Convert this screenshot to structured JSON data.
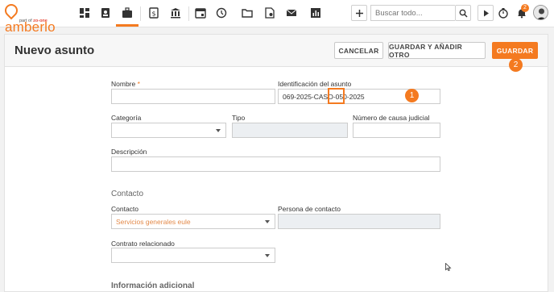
{
  "app": {
    "logo_text": "amberlo",
    "logo_sub_prefix": "part of",
    "logo_sub_brand": "zo-one"
  },
  "nav": {
    "icons": [
      "dashboard-icon",
      "contacts-icon",
      "briefcase-icon",
      "billing-icon",
      "bank-icon",
      "calendar-icon",
      "time-history-icon",
      "folder-icon",
      "document-settings-icon",
      "mail-icon",
      "reports-icon"
    ],
    "search_placeholder": "Buscar todo...",
    "notification_count": "2"
  },
  "page": {
    "title": "Nuevo asunto",
    "buttons": {
      "cancel": "Cancelar",
      "save_add": "Guardar y añadir otro",
      "save": "Guardar"
    },
    "steps": {
      "one": "1",
      "two": "2"
    }
  },
  "form": {
    "name_label": "Nombre",
    "name_required": "*",
    "name_value": "",
    "matter_id_label": "Identificación del asunto",
    "matter_id_value": "069-2025-CASO-050-2025",
    "category_label": "Categoría",
    "category_value": "",
    "type_label": "Tipo",
    "type_value": "",
    "court_case_label": "Número de causa judicial",
    "court_case_value": "",
    "description_label": "Descripción",
    "description_value": "",
    "contact_section": "Contacto",
    "contact_label": "Contacto",
    "contact_value": "Servicios generales eule",
    "contact_person_label": "Persona de contacto",
    "contact_person_value": "",
    "related_contract_label": "Contrato relacionado",
    "related_contract_value": "",
    "additional_section": "Información adicional"
  },
  "colors": {
    "accent": "#f47a20",
    "header_bg": "#f7f7f7",
    "disabled_bg": "#eceff2"
  }
}
